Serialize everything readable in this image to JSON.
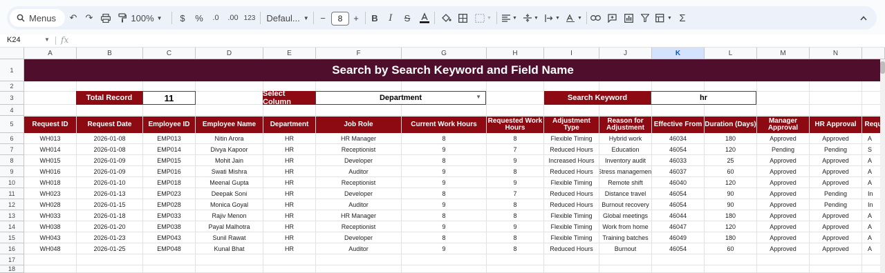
{
  "toolbar": {
    "menus_label": "Menus",
    "zoom": "100%",
    "currency": "$",
    "percent": "%",
    "dec_decrease": ".0",
    "dec_increase": ".00",
    "number_format": "123",
    "font": "Defaul...",
    "font_size": "8",
    "bold": "B",
    "italic": "I",
    "sum": "Σ"
  },
  "formula_bar": {
    "cell_ref": "K24",
    "fx": "fx"
  },
  "columns": [
    "A",
    "B",
    "C",
    "D",
    "E",
    "F",
    "G",
    "H",
    "I",
    "J",
    "K",
    "L",
    "M",
    "N",
    ""
  ],
  "rows": [
    "1",
    "2",
    "3",
    "4",
    "5",
    "6",
    "7",
    "8",
    "9",
    "10",
    "11",
    "12",
    "13",
    "14",
    "15",
    "16",
    "17",
    "18"
  ],
  "sheet": {
    "title": "Search by Search Keyword and Field Name",
    "total_record_label": "Total Record",
    "total_record_value": "11",
    "select_column_label": "Select Column",
    "select_column_value": "Department",
    "search_keyword_label": "Search Keyword",
    "search_keyword_value": "hr"
  },
  "table": {
    "headers": [
      "Request ID",
      "Request Date",
      "Employee ID",
      "Employee Name",
      "Department",
      "Job Role",
      "Current Work Hours",
      "Requested Work Hours",
      "Adjustment Type",
      "Reason for Adjustment",
      "Effective From",
      "Duration (Days)",
      "Manager Approval",
      "HR Approval",
      "Requ"
    ],
    "rows": [
      [
        "WH013",
        "2026-01-08",
        "EMP013",
        "Nitin Arora",
        "HR",
        "HR Manager",
        "8",
        "8",
        "Flexible Timing",
        "Hybrid work",
        "46034",
        "180",
        "Approved",
        "Approved",
        "A"
      ],
      [
        "WH014",
        "2026-01-08",
        "EMP014",
        "Divya Kapoor",
        "HR",
        "Receptionist",
        "9",
        "7",
        "Reduced Hours",
        "Education",
        "46054",
        "120",
        "Pending",
        "Pending",
        "S"
      ],
      [
        "WH015",
        "2026-01-09",
        "EMP015",
        "Mohit Jain",
        "HR",
        "Developer",
        "8",
        "9",
        "Increased Hours",
        "Inventory audit",
        "46033",
        "25",
        "Approved",
        "Approved",
        "A"
      ],
      [
        "WH016",
        "2026-01-09",
        "EMP016",
        "Swati Mishra",
        "HR",
        "Auditor",
        "9",
        "8",
        "Reduced Hours",
        "Stress management",
        "46037",
        "60",
        "Approved",
        "Approved",
        "A"
      ],
      [
        "WH018",
        "2026-01-10",
        "EMP018",
        "Meenal Gupta",
        "HR",
        "Receptionist",
        "9",
        "9",
        "Flexible Timing",
        "Remote shift",
        "46040",
        "120",
        "Approved",
        "Approved",
        "A"
      ],
      [
        "WH023",
        "2026-01-13",
        "EMP023",
        "Deepak Soni",
        "HR",
        "Developer",
        "8",
        "7",
        "Reduced Hours",
        "Distance travel",
        "46054",
        "90",
        "Approved",
        "Pending",
        "In"
      ],
      [
        "WH028",
        "2026-01-15",
        "EMP028",
        "Monica Goyal",
        "HR",
        "Auditor",
        "9",
        "8",
        "Reduced Hours",
        "Burnout recovery",
        "46054",
        "90",
        "Approved",
        "Pending",
        "In"
      ],
      [
        "WH033",
        "2026-01-18",
        "EMP033",
        "Rajiv Menon",
        "HR",
        "HR Manager",
        "8",
        "8",
        "Flexible Timing",
        "Global meetings",
        "46044",
        "180",
        "Approved",
        "Approved",
        "A"
      ],
      [
        "WH038",
        "2026-01-20",
        "EMP038",
        "Payal Malhotra",
        "HR",
        "Receptionist",
        "9",
        "9",
        "Flexible Timing",
        "Work from home",
        "46047",
        "120",
        "Approved",
        "Approved",
        "A"
      ],
      [
        "WH043",
        "2026-01-23",
        "EMP043",
        "Sunil Rawat",
        "HR",
        "Developer",
        "8",
        "8",
        "Flexible Timing",
        "Training batches",
        "46049",
        "180",
        "Approved",
        "Approved",
        "A"
      ],
      [
        "WH048",
        "2026-01-25",
        "EMP048",
        "Kunal Bhat",
        "HR",
        "Auditor",
        "9",
        "8",
        "Reduced Hours",
        "Burnout",
        "46054",
        "60",
        "Approved",
        "Approved",
        "A"
      ]
    ]
  },
  "colors": {
    "banner": "#4e0e2c",
    "header": "#8e0a12",
    "selected_col": "#d3e3fd"
  }
}
